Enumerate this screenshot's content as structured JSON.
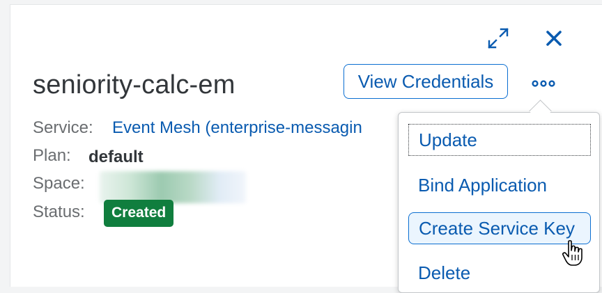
{
  "header": {
    "title": "seniority-calc-em",
    "view_credentials_label": "View Credentials",
    "fullscreen_icon": "fullscreen-icon",
    "close_icon": "close-icon",
    "more_icon": "overflow-icon"
  },
  "details": {
    "service_label": "Service:",
    "service_value": "Event Mesh (enterprise-messagin",
    "plan_label": "Plan:",
    "plan_value": "default",
    "space_label": "Space:",
    "status_label": "Status:",
    "status_value": "Created"
  },
  "menu": {
    "items": [
      {
        "label": "Update"
      },
      {
        "label": "Bind Application"
      },
      {
        "label": "Create Service Key"
      },
      {
        "label": "Delete"
      }
    ]
  },
  "colors": {
    "accent": "#0a6ed1",
    "link": "#0a5bb0",
    "status_success": "#107e3e",
    "text": "#32363a",
    "label": "#6a6d70"
  }
}
